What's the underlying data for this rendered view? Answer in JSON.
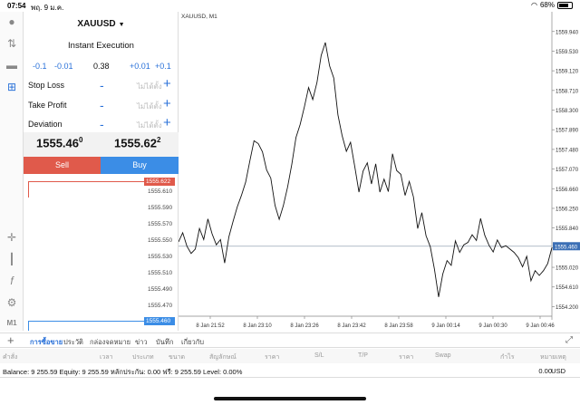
{
  "status_bar": {
    "time": "07:54",
    "date": "พฤ. 9 ม.ค.",
    "battery": "68%"
  },
  "order_panel": {
    "symbol": "XAUUSD",
    "execution": "Instant Execution",
    "volume_steps": [
      "-0.1",
      "-0.01",
      "0.38",
      "+0.01",
      "+0.1"
    ],
    "fields": [
      {
        "label": "Stop Loss",
        "value": "ไม่ได้ตั้ง"
      },
      {
        "label": "Take Profit",
        "value": "ไม่ได้ตั้ง"
      },
      {
        "label": "Deviation",
        "value": "ไม่ได้ตั้ง"
      }
    ],
    "sell_price_main": "1555.46",
    "sell_price_sup": "0",
    "buy_price_main": "1555.62",
    "buy_price_sup": "2",
    "sell_label": "Sell",
    "buy_label": "Buy",
    "depth_prices": [
      "1555.622",
      "1555.610",
      "1555.590",
      "1555.570",
      "1555.550",
      "1555.530",
      "1555.510",
      "1555.490",
      "1555.470",
      "1555.460"
    ]
  },
  "chart_data": {
    "type": "line",
    "title": "XAUUSD, M1",
    "x_ticks": [
      "8 Jan 21:52",
      "8 Jan 23:10",
      "8 Jan 23:26",
      "8 Jan 23:42",
      "8 Jan 23:58",
      "9 Jan 00:14",
      "9 Jan 00:30",
      "9 Jan 00:46"
    ],
    "y_ticks": [
      "1559.940",
      "1559.530",
      "1559.120",
      "1558.710",
      "1558.300",
      "1557.890",
      "1557.480",
      "1557.070",
      "1556.660",
      "1556.250",
      "1555.840",
      "1555.430",
      "1555.020",
      "1554.610",
      "1554.200"
    ],
    "ylim": [
      1554.0,
      1560.2
    ],
    "current_price": "1555.460",
    "values": [
      1555.55,
      1555.74,
      1555.46,
      1555.31,
      1555.4,
      1555.83,
      1555.6,
      1556.03,
      1555.72,
      1555.49,
      1555.6,
      1555.11,
      1555.66,
      1555.98,
      1556.28,
      1556.52,
      1556.8,
      1557.24,
      1557.66,
      1557.6,
      1557.43,
      1557.05,
      1556.88,
      1556.31,
      1556.02,
      1556.31,
      1556.7,
      1557.17,
      1557.73,
      1558.0,
      1558.37,
      1558.77,
      1558.52,
      1558.88,
      1559.44,
      1559.71,
      1559.22,
      1558.97,
      1558.2,
      1557.77,
      1557.44,
      1557.63,
      1557.13,
      1556.59,
      1557.03,
      1557.2,
      1556.76,
      1557.18,
      1556.59,
      1556.86,
      1556.6,
      1557.39,
      1557.04,
      1556.96,
      1556.52,
      1556.81,
      1556.49,
      1555.83,
      1556.16,
      1555.68,
      1555.45,
      1554.98,
      1554.4,
      1554.88,
      1555.16,
      1555.06,
      1555.57,
      1555.33,
      1555.49,
      1555.54,
      1555.7,
      1555.58,
      1556.04,
      1555.69,
      1555.48,
      1555.34,
      1555.59,
      1555.43,
      1555.47,
      1555.4,
      1555.33,
      1555.22,
      1555.03,
      1555.25,
      1554.74,
      1554.95,
      1554.85,
      1554.95,
      1555.1,
      1555.43
    ]
  },
  "bottom_tabs": [
    "การซื้อขาย",
    "ประวัติ",
    "กล่องจดหมาย",
    "ข่าว",
    "บันทึก",
    "เกี่ยวกับ"
  ],
  "columns": [
    "คำสั่ง",
    "เวลา",
    "ประเภท",
    "ขนาด",
    "สัญลักษณ์",
    "ราคา",
    "S/L",
    "T/P",
    "ราคา",
    "Swap",
    "กำไร",
    "หมายเหตุ"
  ],
  "balance": {
    "text": "Balance: 9 255.59 Equity: 9 255.59 หลักประกัน: 0.00 ฟรี: 9 255.59 Level: 0.00%",
    "profit": "0.00",
    "currency": "USD"
  },
  "colors": {
    "sell": "#e05a4b",
    "buy": "#3b8de6",
    "accent": "#2b72d9"
  }
}
